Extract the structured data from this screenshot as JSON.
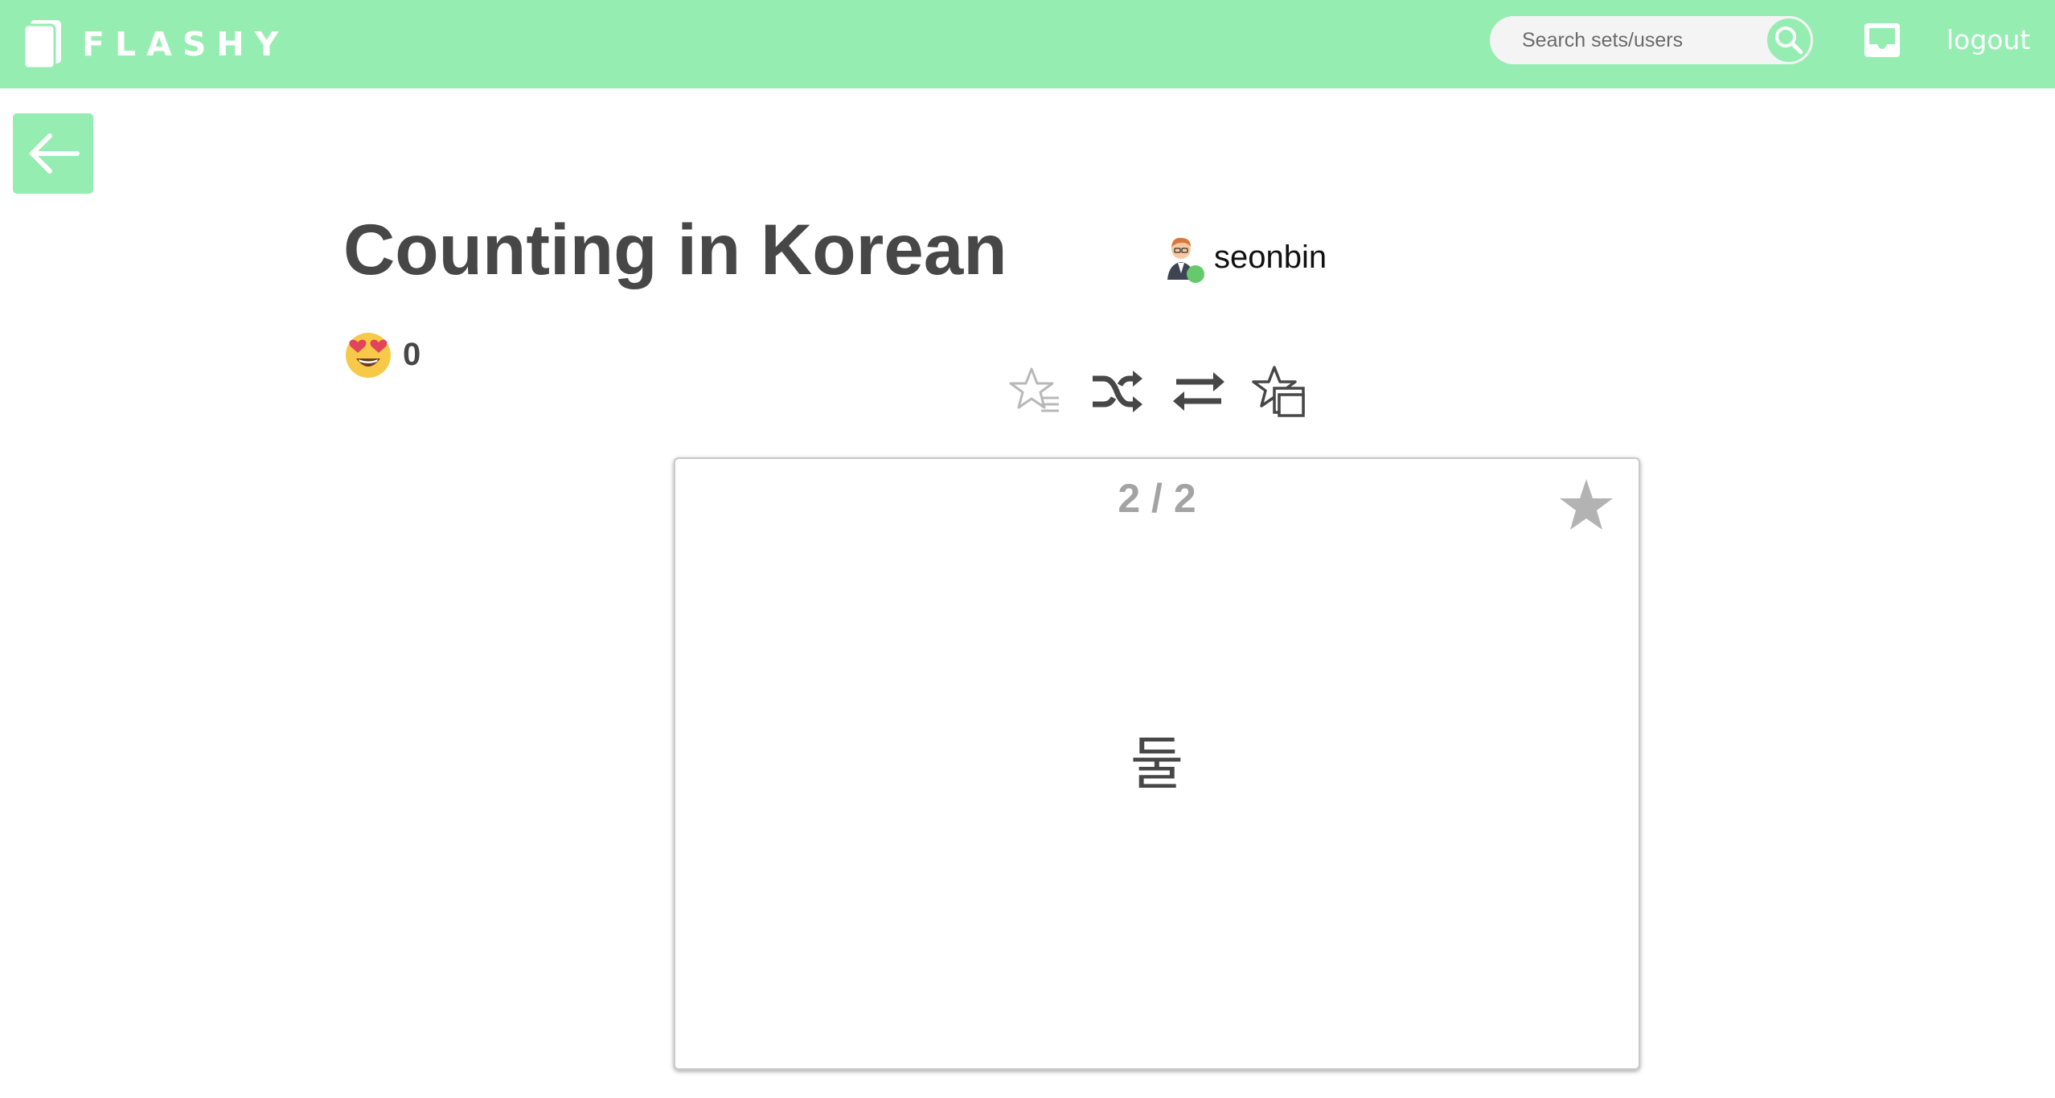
{
  "header": {
    "brand": "FLASHY",
    "search_placeholder": "Search sets/users",
    "logout_label": "logout"
  },
  "set": {
    "title": "Counting in Korean",
    "author": "seonbin",
    "likes": "0"
  },
  "toolbar": {
    "icons": [
      "starred-filter-icon",
      "shuffle-icon",
      "flip-sides-icon",
      "starred-cards-icon"
    ]
  },
  "card": {
    "counter": "2 / 2",
    "term": "둘"
  },
  "colors": {
    "accent": "#95edb1",
    "title_text": "#474747",
    "muted": "#a3a3a3",
    "online": "#66c96c"
  }
}
